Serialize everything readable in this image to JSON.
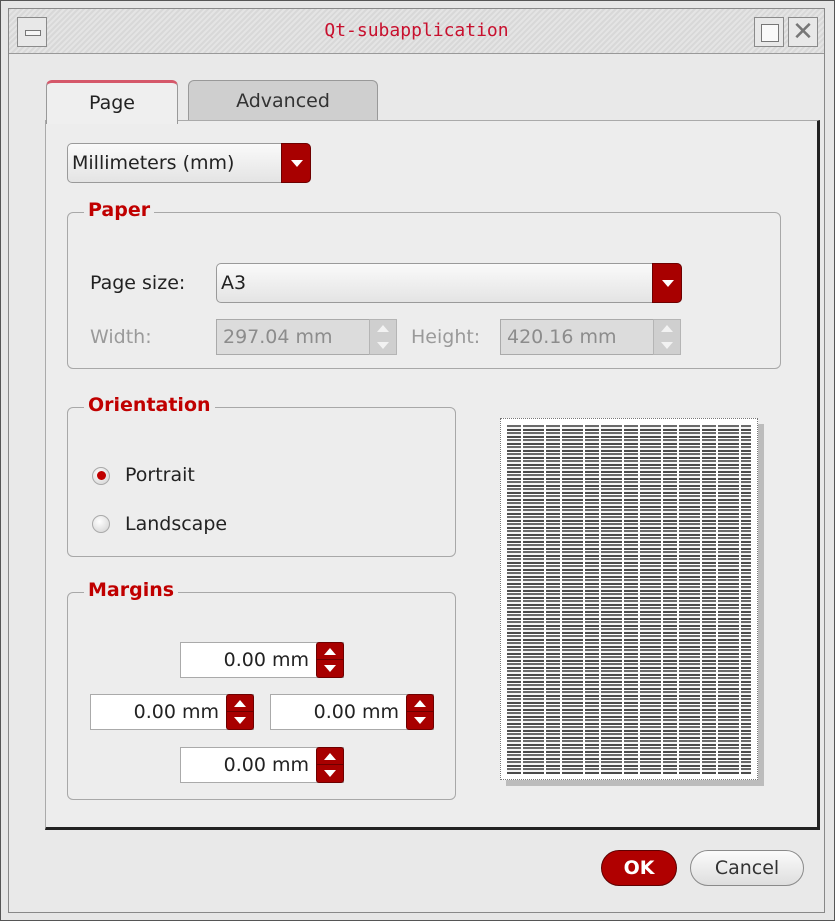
{
  "window": {
    "title": "Qt-subapplication"
  },
  "tabs": [
    {
      "label": "Page",
      "active": true
    },
    {
      "label": "Advanced",
      "active": false
    }
  ],
  "units": {
    "selected": "Millimeters (mm)"
  },
  "paper": {
    "group_title": "Paper",
    "page_size_label": "Page size:",
    "page_size_value": "A3",
    "width_label": "Width:",
    "width_value": "297.04 mm",
    "height_label": "Height:",
    "height_value": "420.16 mm"
  },
  "orientation": {
    "group_title": "Orientation",
    "options": [
      {
        "label": "Portrait",
        "checked": true
      },
      {
        "label": "Landscape",
        "checked": false
      }
    ]
  },
  "margins": {
    "group_title": "Margins",
    "top": "0.00 mm",
    "left": "0.00 mm",
    "right": "0.00 mm",
    "bottom": "0.00 mm"
  },
  "buttons": {
    "ok": "OK",
    "cancel": "Cancel"
  },
  "colors": {
    "accent": "#c00000",
    "title_text": "#c8102e"
  }
}
